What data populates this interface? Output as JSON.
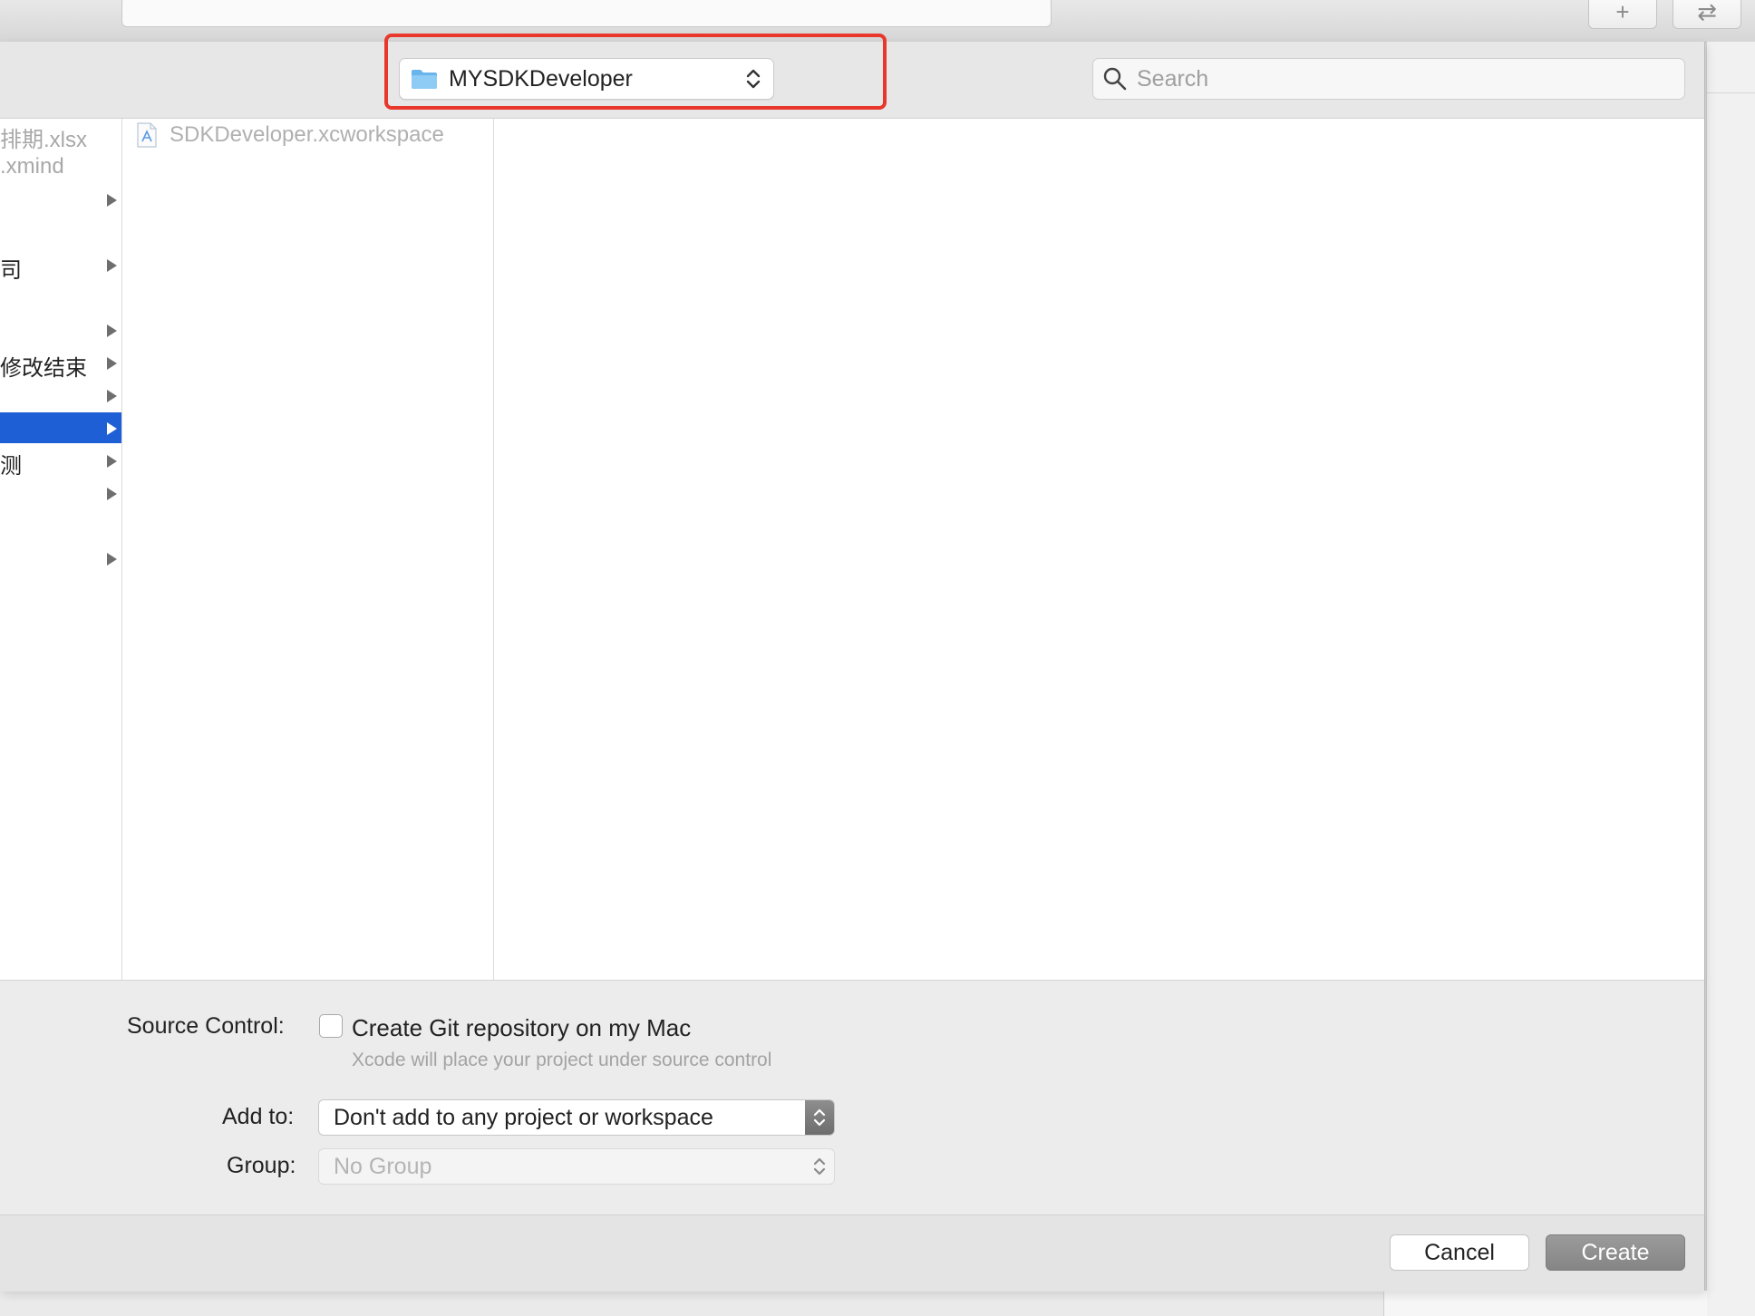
{
  "background": {
    "toolbar_buttons": [
      {
        "icon": "plus-icon",
        "glyph": "+"
      },
      {
        "icon": "swap-arrows-icon",
        "glyph": "⇄"
      }
    ]
  },
  "sheet": {
    "location": {
      "folder_icon": "folder-icon",
      "label": "MYSDKDeveloper"
    },
    "search": {
      "placeholder": "Search",
      "value": ""
    },
    "sidebar_column": {
      "items": [
        {
          "label": "排期.xlsx",
          "style": "dim",
          "has_arrow": false,
          "selected": false
        },
        {
          "label": ".xmind",
          "style": "dim",
          "has_arrow": false,
          "selected": false
        },
        {
          "label": "",
          "style": "dark",
          "has_arrow": true,
          "selected": false
        },
        {
          "label": "",
          "style": "dark",
          "has_arrow": false,
          "selected": false
        },
        {
          "label": "司",
          "style": "dark",
          "has_arrow": true,
          "selected": false
        },
        {
          "label": "",
          "style": "dark",
          "has_arrow": false,
          "selected": false
        },
        {
          "label": "",
          "style": "dark",
          "has_arrow": true,
          "selected": false
        },
        {
          "label": "修改结束",
          "style": "dark",
          "has_arrow": true,
          "selected": false
        },
        {
          "label": "",
          "style": "dark",
          "has_arrow": true,
          "selected": false
        },
        {
          "label": "",
          "style": "dark",
          "has_arrow": true,
          "selected": true
        },
        {
          "label": "测",
          "style": "dark",
          "has_arrow": true,
          "selected": false
        },
        {
          "label": "",
          "style": "dark",
          "has_arrow": true,
          "selected": false
        },
        {
          "label": "",
          "style": "dark",
          "has_arrow": false,
          "selected": false
        },
        {
          "label": "",
          "style": "dark",
          "has_arrow": true,
          "selected": false
        }
      ]
    },
    "content_column": {
      "files": [
        {
          "name": "SDKDeveloper.xcworkspace",
          "icon": "xcworkspace-icon"
        }
      ]
    },
    "options": {
      "source_control_label": "Source Control:",
      "git_checkbox_label": "Create Git repository on my Mac",
      "git_checked": false,
      "git_help": "Xcode will place your project under source control",
      "add_to_label": "Add to:",
      "add_to_value": "Don't add to any project or workspace",
      "group_label": "Group:",
      "group_value": "No Group"
    },
    "footer": {
      "cancel_label": "Cancel",
      "create_label": "Create"
    }
  },
  "colors": {
    "highlight": "#e8382c",
    "selection": "#1f5fd6",
    "folder": "#6ab4ec"
  }
}
